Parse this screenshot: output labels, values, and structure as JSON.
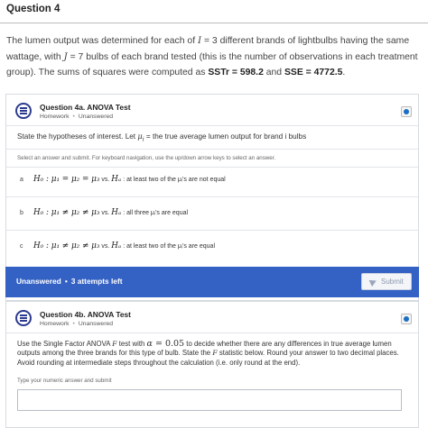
{
  "page": {
    "heading": "Question 4",
    "intro": {
      "p1": "The lumen output was determined for each of ",
      "I_var": "I",
      "I_eq": " = 3",
      "p2": " different brands of lightbulbs having the same wattage, with ",
      "J_var": "J",
      "J_eq": " = 7",
      "p3": " bulbs of each brand tested (this is the number of observations in each treatment group). The sums of squares were computed as ",
      "sstr": "SSTr = 598.2",
      "p4": " and ",
      "sse": "SSE = 4772.5",
      "p5": "."
    }
  },
  "q4a": {
    "title": "Question 4a. ANOVA Test",
    "type": "Homework",
    "status": "Unanswered",
    "prompt_text": "State the hypotheses of interest. Let ",
    "prompt_mu": "μ",
    "prompt_sub": "i",
    "prompt_rest": " = the true average lumen output for brand i bulbs",
    "hint": "Select an answer and submit. For keyboard navigation, use the up/down arrow keys to select an answer.",
    "choices": [
      {
        "letter": "a",
        "hyp": "H₀ : μ₁ = μ₂ = μ₃",
        "vs": " vs. ",
        "alt": "Hₐ",
        "text": " : at least two of the μᵢ's are not equal"
      },
      {
        "letter": "b",
        "hyp": "H₀ : μ₁ ≠ μ₂ ≠ μ₃",
        "vs": " vs. ",
        "alt": "Hₐ",
        "text": " : all three μᵢ's are equal"
      },
      {
        "letter": "c",
        "hyp": "H₀ : μ₁ ≠ μ₂ ≠ μ₃",
        "vs": " vs. ",
        "alt": "Hₐ",
        "text": " : at least two of the μᵢ's are equal"
      }
    ],
    "footer_status": "Unanswered",
    "footer_attempts": "3 attempts left",
    "submit_label": "Submit"
  },
  "q4b": {
    "title": "Question 4b. ANOVA Test",
    "type": "Homework",
    "status": "Unanswered",
    "text1": "Use the Single Factor ANOVA ",
    "text_f": "F",
    "text2": " test with ",
    "alpha": "α",
    "alpha_eq": " = 0.05",
    "text3": " to decide whether there are any differences in true average lumen outputs among the three brands for this type of bulb. State the ",
    "text_f2": "F",
    "text4": " statistic below. Round your answer to two decimal places. Avoid rounding at intermediate steps throughout the calculation (i.e. only round at the end).",
    "hint": "Type your numeric answer and submit",
    "answer_value": ""
  },
  "colors": {
    "accent_bar": "#3361c4",
    "icon": "#2c3b8f",
    "badge": "#1b6ec2"
  },
  "icons": {
    "question": "question-list-icon",
    "info": "info-badge-icon",
    "submit": "send-icon"
  }
}
